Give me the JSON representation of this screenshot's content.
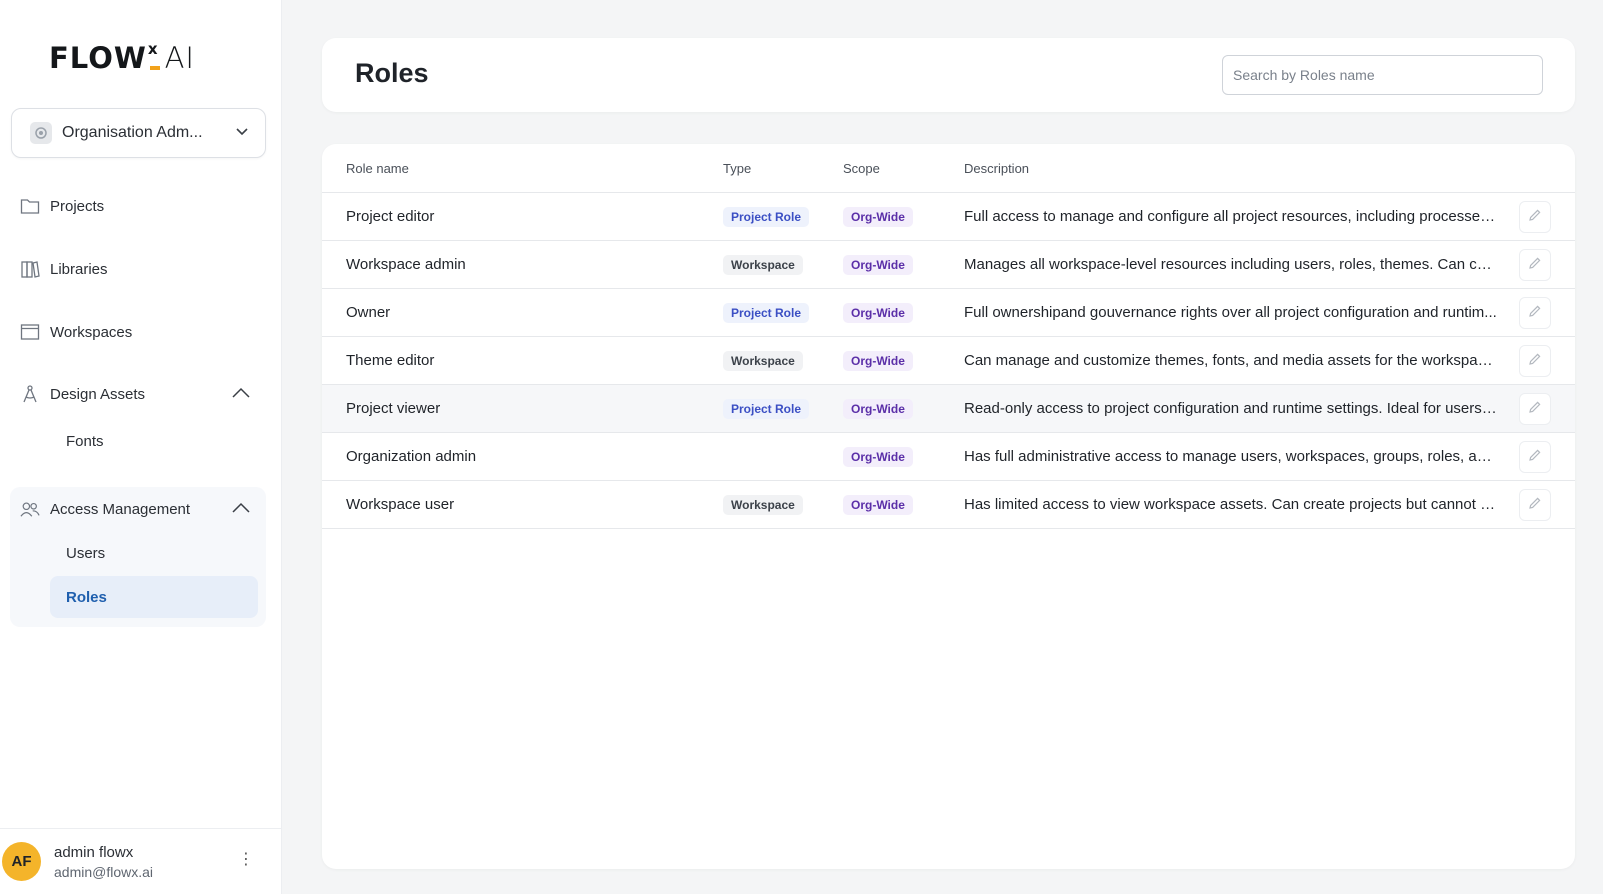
{
  "brand": {
    "logo_flow": "FLOW",
    "logo_x": "x",
    "logo_ai": "AI"
  },
  "org_selector": {
    "label": "Organisation Adm..."
  },
  "nav": {
    "projects": "Projects",
    "libraries": "Libraries",
    "workspaces": "Workspaces",
    "design_assets": "Design Assets",
    "fonts": "Fonts",
    "access_management": "Access Management",
    "users": "Users",
    "roles": "Roles"
  },
  "user": {
    "initials": "AF",
    "name": "admin flowx",
    "email": "admin@flowx.ai",
    "menu": "⋮"
  },
  "header": {
    "title": "Roles"
  },
  "search": {
    "placeholder": "Search by Roles name",
    "value": ""
  },
  "table": {
    "columns": {
      "name": "Role name",
      "type": "Type",
      "scope": "Scope",
      "description": "Description"
    },
    "rows": [
      {
        "name": "Project editor",
        "type": "Project Role",
        "type_kind": "proj",
        "scope": "Org-Wide",
        "description": "Full access to manage and configure all project resources, including processes, ..."
      },
      {
        "name": "Workspace admin",
        "type": "Workspace",
        "type_kind": "ws",
        "scope": "Org-Wide",
        "description": "Manages all workspace-level resources including users, roles, themes. Can confi..."
      },
      {
        "name": "Owner",
        "type": "Project Role",
        "type_kind": "proj",
        "scope": "Org-Wide",
        "description": "Full ownershipand gouvernance rights over all project configuration and runtim..."
      },
      {
        "name": "Theme editor",
        "type": "Workspace",
        "type_kind": "ws",
        "scope": "Org-Wide",
        "description": "Can manage and customize themes, fonts, and media assets for the workspace...."
      },
      {
        "name": "Project viewer",
        "type": "Project Role",
        "type_kind": "proj",
        "scope": "Org-Wide",
        "description": "Read-only access to project configuration and runtime settings. Ideal for users ..."
      },
      {
        "name": "Organization admin",
        "type": "",
        "type_kind": "",
        "scope": "Org-Wide",
        "description": "Has full administrative access to manage users, workspaces, groups, roles, and ..."
      },
      {
        "name": "Workspace user",
        "type": "Workspace",
        "type_kind": "ws",
        "scope": "Org-Wide",
        "description": "Has limited access to view workspace assets. Can create projects but cannot m..."
      }
    ]
  },
  "colors": {
    "accent": "#f2a21b",
    "active_nav_bg": "#e7eef9",
    "active_nav_text": "#1f5fae",
    "badge_project": "#3b4fc4",
    "badge_orgwide": "#5b2fa8",
    "avatar": "#f4b42a"
  }
}
